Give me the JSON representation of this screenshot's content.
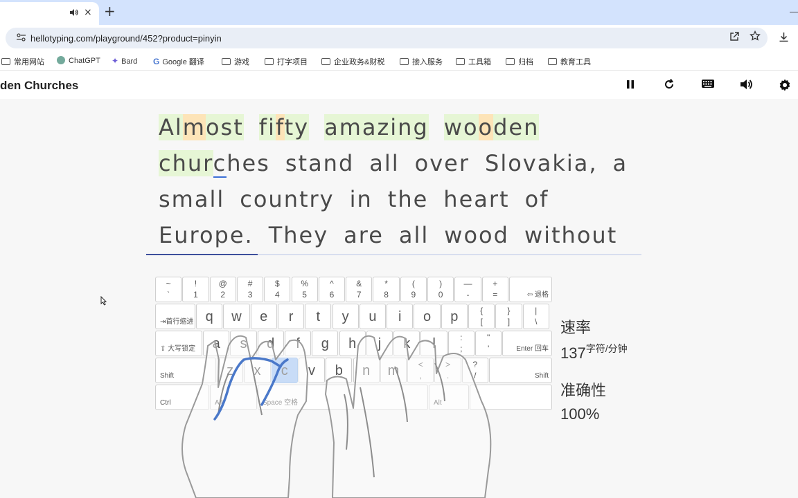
{
  "browser": {
    "tab_audio_icon": "speaker-icon",
    "tab_close": "×",
    "new_tab": "+",
    "minimize": "—",
    "url": "hellotyping.com/playground/452?product=pinyin",
    "bookmarks": [
      {
        "label": "常用网站",
        "icon": "folder-icon"
      },
      {
        "label": "ChatGPT",
        "icon": "chatgpt-icon"
      },
      {
        "label": "Bard",
        "icon": "bard-icon"
      },
      {
        "label": "Google 翻译",
        "icon": "translate-icon"
      },
      {
        "label": "游戏",
        "icon": "folder-icon"
      },
      {
        "label": "打字项目",
        "icon": "folder-icon"
      },
      {
        "label": "企业政务&财税",
        "icon": "folder-icon"
      },
      {
        "label": "接入服务",
        "icon": "folder-icon"
      },
      {
        "label": "工具箱",
        "icon": "folder-icon"
      },
      {
        "label": "归档",
        "icon": "folder-icon"
      },
      {
        "label": "教育工具",
        "icon": "folder-icon"
      }
    ]
  },
  "app": {
    "lesson_title": "den Churches",
    "header_icons": [
      "pause-icon",
      "restart-icon",
      "keyboard-icon",
      "volume-icon",
      "settings-icon"
    ]
  },
  "text": {
    "lines": [
      [
        "Almost",
        "fifty",
        "amazing",
        "wooden"
      ],
      [
        "churches",
        "stand",
        "all",
        "over",
        "Slovakia,",
        "a"
      ],
      [
        "small",
        "country",
        "in",
        "the",
        "heart",
        "of"
      ],
      [
        "Europe.",
        "They",
        "are",
        "all",
        "wood",
        "without"
      ]
    ],
    "progress_fraction": 0.225
  },
  "keyboard": {
    "row1": [
      {
        "top": "~",
        "bot": "`"
      },
      {
        "top": "!",
        "bot": "1"
      },
      {
        "top": "@",
        "bot": "2"
      },
      {
        "top": "#",
        "bot": "3"
      },
      {
        "top": "$",
        "bot": "4"
      },
      {
        "top": "%",
        "bot": "5"
      },
      {
        "top": "^",
        "bot": "6"
      },
      {
        "top": "&",
        "bot": "7"
      },
      {
        "top": "*",
        "bot": "8"
      },
      {
        "top": "(",
        "bot": "9"
      },
      {
        "top": ")",
        "bot": "0"
      },
      {
        "top": "—",
        "bot": "-"
      },
      {
        "top": "+",
        "bot": "="
      }
    ],
    "backspace": "⇦ 退格",
    "tab": "⇥首行缩进",
    "row2": [
      "q",
      "w",
      "e",
      "r",
      "t",
      "y",
      "u",
      "i",
      "o",
      "p"
    ],
    "row2_extra": [
      {
        "top": "{",
        "bot": "["
      },
      {
        "top": "}",
        "bot": "]"
      },
      {
        "top": "|",
        "bot": "\\"
      }
    ],
    "capslock": "⇪ 大写锁定",
    "row3": [
      "a",
      "s",
      "d",
      "f",
      "g",
      "h",
      "j",
      "k",
      "l"
    ],
    "row3_extra": [
      {
        "top": ":",
        "bot": ";"
      },
      {
        "top": "\"",
        "bot": "'"
      }
    ],
    "enter": "Enter 回车",
    "shift_left": "Shift",
    "row4": [
      "z",
      "x",
      "c",
      "v",
      "b",
      "n",
      "m"
    ],
    "row4_extra": [
      {
        "top": "<",
        "bot": ","
      },
      {
        "top": ">",
        "bot": "."
      },
      {
        "top": "?",
        "bot": "/"
      }
    ],
    "shift_right": "Shift",
    "ctrl": "Ctrl",
    "alt_left": "Alt",
    "space": "Space 空格",
    "alt_right": "Alt",
    "active_key": "c",
    "active_color": "#9ec4f4"
  },
  "stats": {
    "speed_label": "速率",
    "speed_value": "137",
    "speed_unit": "字符/分钟",
    "accuracy_label": "准确性",
    "accuracy_value": "100%"
  },
  "colors": {
    "typed_ok": "#e6f6d5",
    "typed_warn": "#fde4b8",
    "progress": "#3d4f9c",
    "finger_highlight": "#4a78c9"
  }
}
